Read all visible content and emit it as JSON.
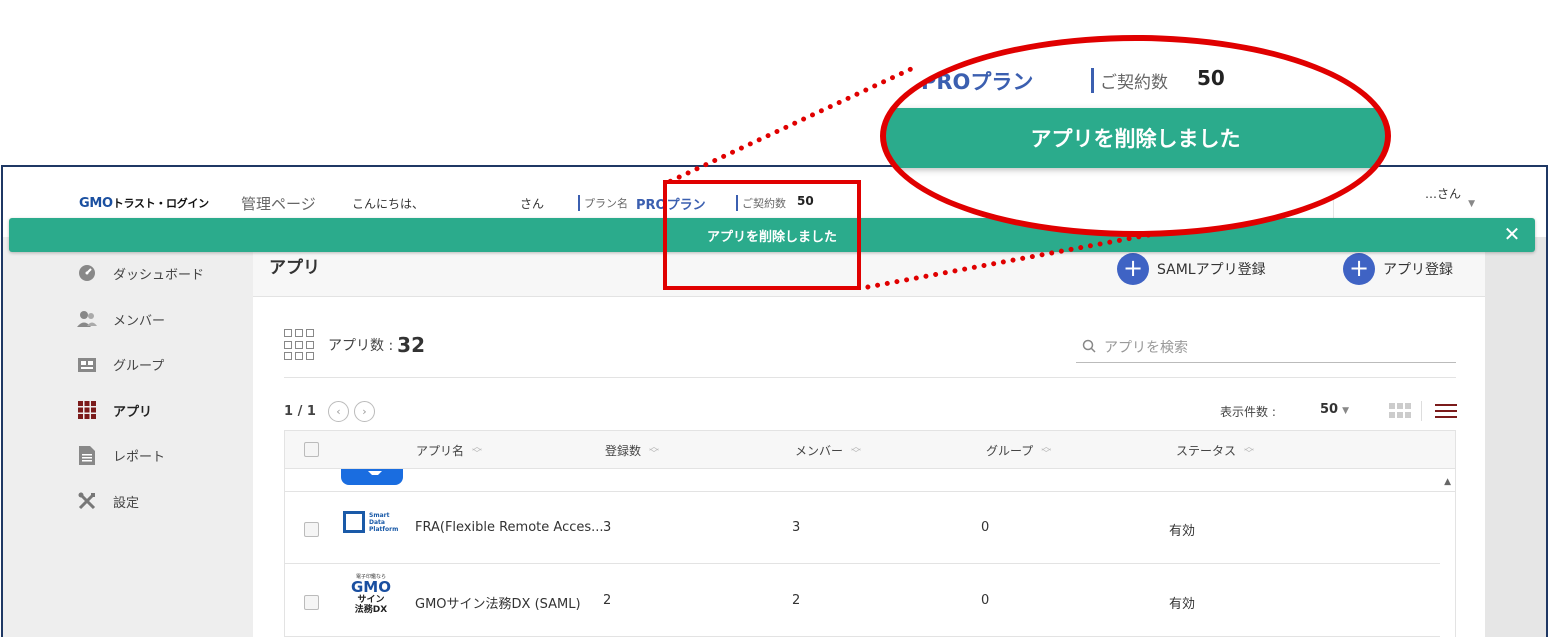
{
  "header": {
    "logo_gmo": "GMO",
    "logo_rest": "トラスト・ログイン",
    "admin_label": "管理ページ",
    "greeting": "こんにちは、",
    "san": "さん",
    "plan_label": "プラン名",
    "plan_value": "PROプラン",
    "contract_label": "ご契約数",
    "contract_value": "50",
    "user_name": "…さん"
  },
  "toast": {
    "message": "アプリを削除しました",
    "close": "✕"
  },
  "sidebar": {
    "items": [
      {
        "label": "ダッシュボード",
        "icon": "dashboard-icon"
      },
      {
        "label": "メンバー",
        "icon": "members-icon"
      },
      {
        "label": "グループ",
        "icon": "group-icon"
      },
      {
        "label": "アプリ",
        "icon": "apps-icon",
        "active": true
      },
      {
        "label": "レポート",
        "icon": "report-icon"
      },
      {
        "label": "設定",
        "icon": "settings-icon"
      }
    ]
  },
  "main": {
    "title": "アプリ",
    "saml_button": "SAMLアプリ登録",
    "add_button": "アプリ登録",
    "count_label": "アプリ数 :",
    "count_value": "32",
    "search_placeholder": "アプリを検索",
    "pager": "1 / 1",
    "per_page_label": "表示件数 :",
    "per_page_value": "50"
  },
  "table": {
    "columns": [
      "アプリ名",
      "登録数",
      "メンバー",
      "グループ",
      "ステータス"
    ],
    "rows": [
      {
        "logo_text": [
          "Smart",
          "Data",
          "Platform"
        ],
        "name": "FRA(Flexible Remote Acces...",
        "registered": "3",
        "members": "3",
        "groups": "0",
        "status": "有効"
      },
      {
        "logo_text": [
          "電子印鑑なら",
          "GMO",
          "サイン",
          "法務DX"
        ],
        "name": "GMOサイン法務DX (SAML)",
        "registered": "2",
        "members": "2",
        "groups": "0",
        "status": "有効"
      }
    ]
  },
  "callout": {
    "plan_value": "PROプラン",
    "contract_label": "ご契約数",
    "contract_value": "50",
    "message": "アプリを削除しました"
  },
  "colors": {
    "accent_green": "#2bab8c",
    "brand_blue": "#3f63c4",
    "highlight_red": "#e00000",
    "active_maroon": "#7b1b1b"
  }
}
